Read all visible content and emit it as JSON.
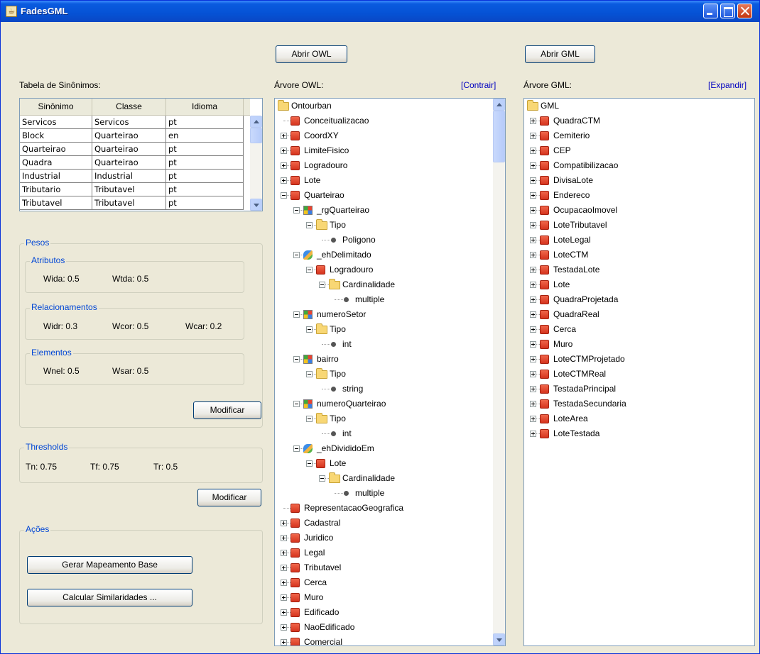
{
  "window": {
    "title": "FadesGML"
  },
  "buttons": {
    "abrir_owl": "Abrir OWL",
    "abrir_gml": "Abrir GML",
    "modificar_pesos": "Modificar",
    "modificar_thresholds": "Modificar",
    "gerar_mapeamento": "Gerar Mapeamento Base",
    "calcular_similaridades": "Calcular Similaridades ..."
  },
  "synonyms": {
    "title": "Tabela de Sinônimos:",
    "columns": [
      "Sinônimo",
      "Classe",
      "Idioma"
    ],
    "rows": [
      [
        "Servicos",
        "Servicos",
        "pt"
      ],
      [
        "Block",
        "Quarteirao",
        "en"
      ],
      [
        "Quarteirao",
        "Quarteirao",
        "pt"
      ],
      [
        "Quadra",
        "Quarteirao",
        "pt"
      ],
      [
        "Industrial",
        "Industrial",
        "pt"
      ],
      [
        "Tributario",
        "Tributavel",
        "pt"
      ],
      [
        "Tributavel",
        "Tributavel",
        "pt"
      ]
    ]
  },
  "pesos": {
    "title": "Pesos",
    "atributos": {
      "title": "Atributos",
      "wida": "Wida: 0.5",
      "wtda": "Wtda: 0.5"
    },
    "relacionamentos": {
      "title": "Relacionamentos",
      "widr": "Widr: 0.3",
      "wcor": "Wcor: 0.5",
      "wcar": "Wcar: 0.2"
    },
    "elementos": {
      "title": "Elementos",
      "wnel": "Wnel: 0.5",
      "wsar": "Wsar: 0.5"
    }
  },
  "thresholds": {
    "title": "Thresholds",
    "tn": "Tn:  0.75",
    "tf": "Tf:  0.75",
    "tr": "Tr:  0.5"
  },
  "acoes": {
    "title": "Ações"
  },
  "owl_tree": {
    "title": "Árvore OWL:",
    "action": "[Contrair]",
    "nodes": [
      {
        "label": "Ontourban",
        "icon": "folder-icon",
        "depth": 0,
        "toggle": "none"
      },
      {
        "label": "Conceitualizacao",
        "icon": "class-icon",
        "depth": 1,
        "toggle": "none"
      },
      {
        "label": "CoordXY",
        "icon": "class-icon",
        "depth": 1,
        "toggle": "closed"
      },
      {
        "label": "LimiteFisico",
        "icon": "class-icon",
        "depth": 1,
        "toggle": "closed"
      },
      {
        "label": "Logradouro",
        "icon": "class-icon",
        "depth": 1,
        "toggle": "closed"
      },
      {
        "label": "Lote",
        "icon": "class-icon",
        "depth": 1,
        "toggle": "closed"
      },
      {
        "label": "Quarteirao",
        "icon": "class-icon",
        "depth": 1,
        "toggle": "open"
      },
      {
        "label": "_rgQuarteirao",
        "icon": "datatype-property-icon",
        "depth": 2,
        "toggle": "open"
      },
      {
        "label": "Tipo",
        "icon": "folder-icon",
        "depth": 3,
        "toggle": "open"
      },
      {
        "label": "Poligono",
        "icon": "bullet-icon",
        "depth": 4,
        "toggle": "none"
      },
      {
        "label": "_ehDelimitado",
        "icon": "object-property-icon",
        "depth": 2,
        "toggle": "open"
      },
      {
        "label": "Logradouro",
        "icon": "class-icon",
        "depth": 3,
        "toggle": "open"
      },
      {
        "label": "Cardinalidade",
        "icon": "folder-icon",
        "depth": 4,
        "toggle": "open"
      },
      {
        "label": "multiple",
        "icon": "bullet-icon",
        "depth": 5,
        "toggle": "none"
      },
      {
        "label": "numeroSetor",
        "icon": "datatype-property-icon",
        "depth": 2,
        "toggle": "open"
      },
      {
        "label": "Tipo",
        "icon": "folder-icon",
        "depth": 3,
        "toggle": "open"
      },
      {
        "label": "int",
        "icon": "bullet-icon",
        "depth": 4,
        "toggle": "none"
      },
      {
        "label": "bairro",
        "icon": "datatype-property-icon",
        "depth": 2,
        "toggle": "open"
      },
      {
        "label": "Tipo",
        "icon": "folder-icon",
        "depth": 3,
        "toggle": "open"
      },
      {
        "label": "string",
        "icon": "bullet-icon",
        "depth": 4,
        "toggle": "none"
      },
      {
        "label": "numeroQuarteirao",
        "icon": "datatype-property-icon",
        "depth": 2,
        "toggle": "open"
      },
      {
        "label": "Tipo",
        "icon": "folder-icon",
        "depth": 3,
        "toggle": "open"
      },
      {
        "label": "int",
        "icon": "bullet-icon",
        "depth": 4,
        "toggle": "none"
      },
      {
        "label": "_ehDivididoEm",
        "icon": "object-property-icon",
        "depth": 2,
        "toggle": "open"
      },
      {
        "label": "Lote",
        "icon": "class-icon",
        "depth": 3,
        "toggle": "open"
      },
      {
        "label": "Cardinalidade",
        "icon": "folder-icon",
        "depth": 4,
        "toggle": "open"
      },
      {
        "label": "multiple",
        "icon": "bullet-icon",
        "depth": 5,
        "toggle": "none"
      },
      {
        "label": "RepresentacaoGeografica",
        "icon": "class-icon",
        "depth": 1,
        "toggle": "none"
      },
      {
        "label": "Cadastral",
        "icon": "class-icon",
        "depth": 1,
        "toggle": "closed"
      },
      {
        "label": "Juridico",
        "icon": "class-icon",
        "depth": 1,
        "toggle": "closed"
      },
      {
        "label": "Legal",
        "icon": "class-icon",
        "depth": 1,
        "toggle": "closed"
      },
      {
        "label": "Tributavel",
        "icon": "class-icon",
        "depth": 1,
        "toggle": "closed"
      },
      {
        "label": "Cerca",
        "icon": "class-icon",
        "depth": 1,
        "toggle": "closed"
      },
      {
        "label": "Muro",
        "icon": "class-icon",
        "depth": 1,
        "toggle": "closed"
      },
      {
        "label": "Edificado",
        "icon": "class-icon",
        "depth": 1,
        "toggle": "closed"
      },
      {
        "label": "NaoEdificado",
        "icon": "class-icon",
        "depth": 1,
        "toggle": "closed"
      },
      {
        "label": "Comercial",
        "icon": "class-icon",
        "depth": 1,
        "toggle": "closed"
      }
    ]
  },
  "gml_tree": {
    "title": "Árvore GML:",
    "action": "[Expandir]",
    "nodes": [
      {
        "label": "GML",
        "icon": "folder-icon",
        "depth": 0,
        "toggle": "none"
      },
      {
        "label": "QuadraCTM",
        "icon": "class-icon",
        "depth": 1,
        "toggle": "closed"
      },
      {
        "label": "Cemiterio",
        "icon": "class-icon",
        "depth": 1,
        "toggle": "closed"
      },
      {
        "label": "CEP",
        "icon": "class-icon",
        "depth": 1,
        "toggle": "closed"
      },
      {
        "label": "Compatibilizacao",
        "icon": "class-icon",
        "depth": 1,
        "toggle": "closed"
      },
      {
        "label": "DivisaLote",
        "icon": "class-icon",
        "depth": 1,
        "toggle": "closed"
      },
      {
        "label": "Endereco",
        "icon": "class-icon",
        "depth": 1,
        "toggle": "closed"
      },
      {
        "label": "OcupacaoImovel",
        "icon": "class-icon",
        "depth": 1,
        "toggle": "closed"
      },
      {
        "label": "LoteTributavel",
        "icon": "class-icon",
        "depth": 1,
        "toggle": "closed"
      },
      {
        "label": "LoteLegal",
        "icon": "class-icon",
        "depth": 1,
        "toggle": "closed"
      },
      {
        "label": "LoteCTM",
        "icon": "class-icon",
        "depth": 1,
        "toggle": "closed"
      },
      {
        "label": "TestadaLote",
        "icon": "class-icon",
        "depth": 1,
        "toggle": "closed"
      },
      {
        "label": "Lote",
        "icon": "class-icon",
        "depth": 1,
        "toggle": "closed"
      },
      {
        "label": "QuadraProjetada",
        "icon": "class-icon",
        "depth": 1,
        "toggle": "closed"
      },
      {
        "label": "QuadraReal",
        "icon": "class-icon",
        "depth": 1,
        "toggle": "closed"
      },
      {
        "label": "Cerca",
        "icon": "class-icon",
        "depth": 1,
        "toggle": "closed"
      },
      {
        "label": "Muro",
        "icon": "class-icon",
        "depth": 1,
        "toggle": "closed"
      },
      {
        "label": "LoteCTMProjetado",
        "icon": "class-icon",
        "depth": 1,
        "toggle": "closed"
      },
      {
        "label": "LoteCTMReal",
        "icon": "class-icon",
        "depth": 1,
        "toggle": "closed"
      },
      {
        "label": "TestadaPrincipal",
        "icon": "class-icon",
        "depth": 1,
        "toggle": "closed"
      },
      {
        "label": "TestadaSecundaria",
        "icon": "class-icon",
        "depth": 1,
        "toggle": "closed"
      },
      {
        "label": "LoteArea",
        "icon": "class-icon",
        "depth": 1,
        "toggle": "closed"
      },
      {
        "label": "LoteTestada",
        "icon": "class-icon",
        "depth": 1,
        "toggle": "closed"
      }
    ]
  }
}
